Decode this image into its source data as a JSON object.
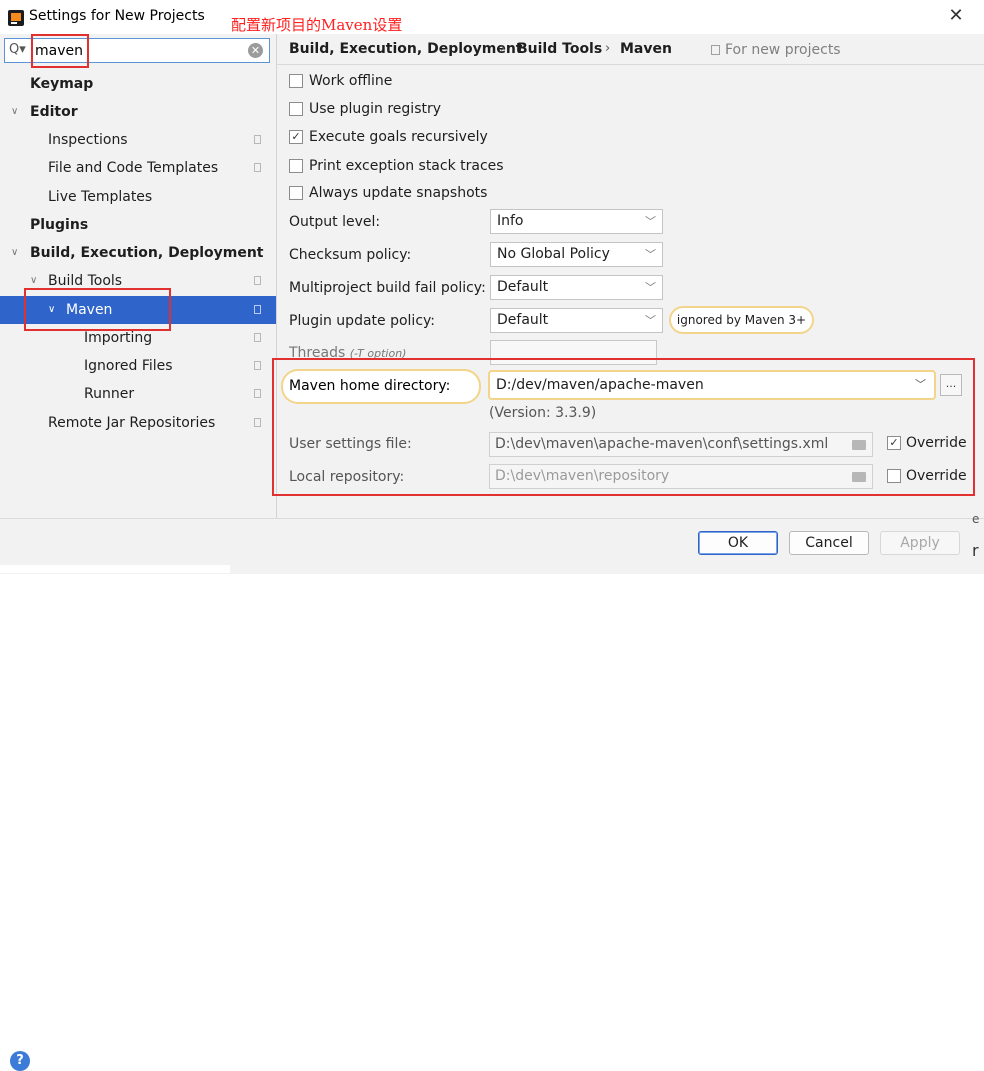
{
  "window": {
    "title": "Settings for New Projects",
    "annotation": "配置新项目的Maven设置",
    "close_glyph": "✕"
  },
  "search": {
    "value": "maven",
    "icon": "search-icon",
    "clear_glyph": "✕"
  },
  "sidebar": {
    "items": [
      {
        "label": "Keymap"
      },
      {
        "label": "Editor"
      },
      {
        "label": "Inspections"
      },
      {
        "label": "File and Code Templates"
      },
      {
        "label": "Live Templates"
      },
      {
        "label": "Plugins"
      },
      {
        "label": "Build, Execution, Deployment"
      },
      {
        "label": "Build Tools"
      },
      {
        "label": "Maven"
      },
      {
        "label": "Importing"
      },
      {
        "label": "Ignored Files"
      },
      {
        "label": "Runner"
      },
      {
        "label": "Remote Jar Repositories"
      }
    ]
  },
  "breadcrumb": {
    "parts": [
      "Build, Execution, Deployment",
      "Build Tools",
      "Maven"
    ],
    "separator": "›",
    "scope": "For new projects"
  },
  "options": {
    "work_offline": {
      "label": "Work offline",
      "checked": false
    },
    "plugin_registry": {
      "label": "Use plugin registry",
      "checked": false
    },
    "goals_recursive": {
      "label": "Execute goals recursively",
      "checked": true
    },
    "stack_traces": {
      "label": "Print exception stack traces",
      "checked": false
    },
    "update_snapshots": {
      "label": "Always update snapshots",
      "checked": false
    }
  },
  "fields": {
    "output_level": {
      "label": "Output level:",
      "value": "Info"
    },
    "checksum": {
      "label": "Checksum policy:",
      "value": "No Global Policy"
    },
    "multiproject": {
      "label": "Multiproject build fail policy:",
      "value": "Default"
    },
    "plugin_update": {
      "label": "Plugin update policy:",
      "value": "Default",
      "tip": "ignored by Maven 3+"
    },
    "threads": {
      "label": "Threads",
      "hint": "(-T option)",
      "value": ""
    },
    "maven_home": {
      "label": "Maven home directory:",
      "value": "D:/dev/maven/apache-maven",
      "browse": "..."
    },
    "version": "(Version: 3.3.9)",
    "user_settings": {
      "label": "User settings file:",
      "value": "D:\\dev\\maven\\apache-maven\\conf\\settings.xml",
      "override_label": "Override",
      "override_checked": true
    },
    "local_repo": {
      "label": "Local repository:",
      "value": "D:\\dev\\maven\\repository",
      "override_label": "Override",
      "override_checked": false
    }
  },
  "buttons": {
    "ok": "OK",
    "cancel": "Cancel",
    "apply": "Apply"
  },
  "help_glyph": "?",
  "edge_text": {
    "top": "e",
    "bottom": "r"
  },
  "glyphs": {
    "check": "✓",
    "chevron_down": "﹀",
    "tree_expanded": "∨"
  },
  "colors": {
    "selection": "#2f65ca",
    "annotation": "#ff2020",
    "highlight": "#f2d58a"
  }
}
